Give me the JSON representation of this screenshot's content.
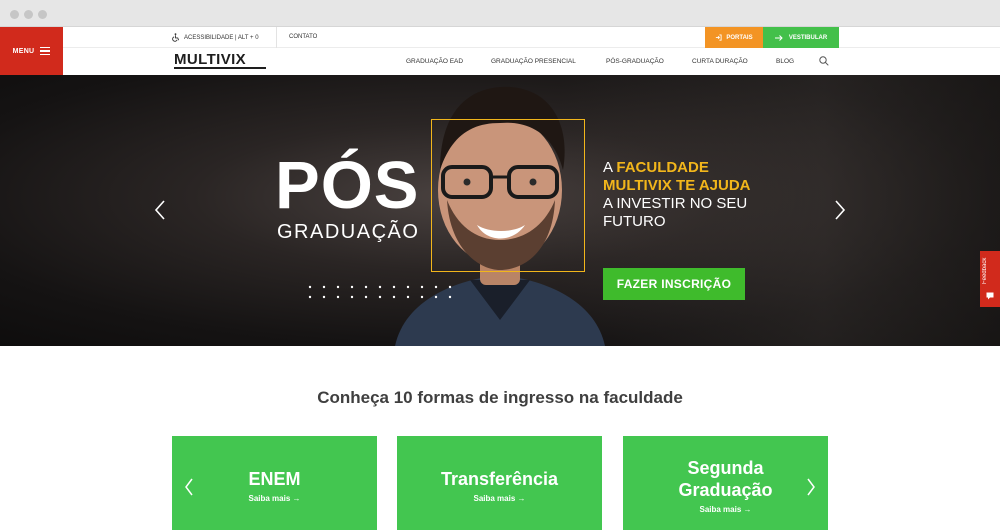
{
  "header": {
    "menu_label": "MENU",
    "accessibility": "ACESSIBILIDADE | ALT + 0",
    "contact": "CONTATO",
    "portais": "PORTAIS",
    "vestibular": "VESTIBULAR",
    "logo": "MULTIVIX",
    "nav": [
      "GRADUAÇÃO EAD",
      "GRADUAÇÃO PRESENCIAL",
      "PÓS-GRADUAÇÃO",
      "CURTA DURAÇÃO",
      "BLOG"
    ]
  },
  "hero": {
    "big": "PÓS",
    "sub": "GRADUAÇÃO",
    "tagline_1": "A ",
    "tagline_2": "FACULDADE",
    "tagline_3": "MULTIVIX TE AJUDA",
    "tagline_4": "A INVESTIR NO SEU",
    "tagline_5": "FUTURO",
    "cta": "FAZER INSCRIÇÃO"
  },
  "feedback": "Feedback",
  "section": {
    "title": "Conheça 10 formas de ingresso na faculdade",
    "cards": [
      {
        "title": "ENEM",
        "link": "Saiba mais →"
      },
      {
        "title": "Transferência",
        "link": "Saiba mais →"
      },
      {
        "title_1": "Segunda",
        "title_2": "Graduação",
        "link": "Saiba mais →"
      }
    ]
  },
  "colors": {
    "red": "#d12a1c",
    "orange": "#f39424",
    "green": "#43c04a",
    "yellow": "#f2b61b"
  }
}
